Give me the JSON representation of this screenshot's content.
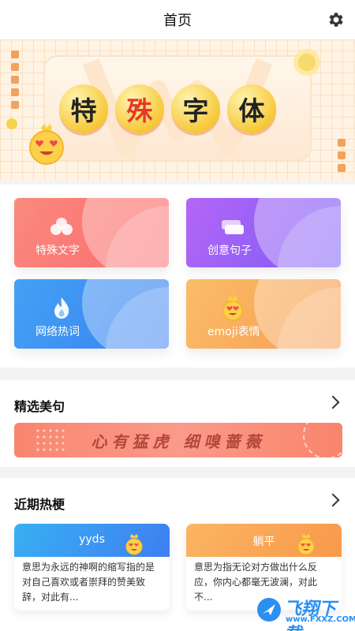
{
  "header": {
    "title": "首页",
    "settings_icon": "gear-icon"
  },
  "banner": {
    "chars": [
      "特",
      "殊",
      "字",
      "体"
    ]
  },
  "features": [
    {
      "label": "特殊文字",
      "icon": "cloud-icon"
    },
    {
      "label": "创意句子",
      "icon": "cards-icon"
    },
    {
      "label": "网络热词",
      "icon": "flame-icon"
    },
    {
      "label": "emoji表情",
      "icon": "emoji-face-icon"
    }
  ],
  "featured": {
    "title": "精选美句",
    "quote": "心有猛虎 细嗅蔷薇"
  },
  "trending": {
    "title": "近期热梗",
    "items": [
      {
        "term": "yyds",
        "desc": "意思为永远的神啊的缩写指的是对自己喜欢或者崇拜的赞美致辞，对此有..."
      },
      {
        "term": "躺平",
        "desc": "意思为指无论对方做出什么反应，你内心都毫无波澜，对此不..."
      }
    ]
  },
  "watermark": {
    "text": "飞翔下载",
    "url": "www.FXXZ.COM"
  }
}
